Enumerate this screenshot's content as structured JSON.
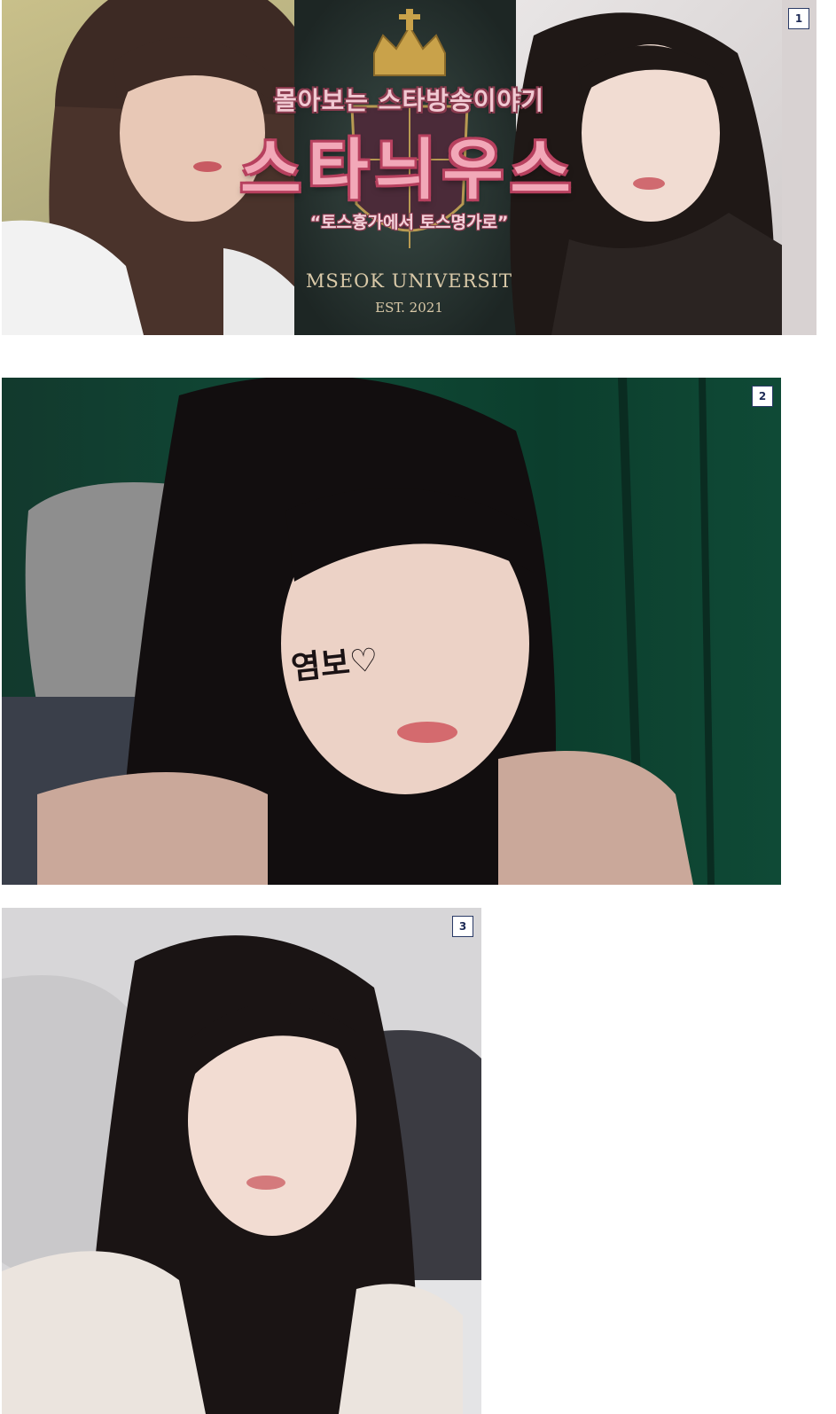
{
  "photos": [
    {
      "index_label": "1",
      "subtitle": "몰아보는 스타방송이야기",
      "title": "스타늬우스",
      "quote": "“토스흉가에서 토스명가로”",
      "crest_text": "MSEOK UNIVERSIT",
      "crest_est": "EST. 2021"
    },
    {
      "index_label": "2",
      "cheek_text": "염보♡"
    },
    {
      "index_label": "3"
    }
  ],
  "colors": {
    "title_pink": "#f2a8b8",
    "badge_border": "#2a3a66",
    "curtain_green": "#0f4a36"
  }
}
